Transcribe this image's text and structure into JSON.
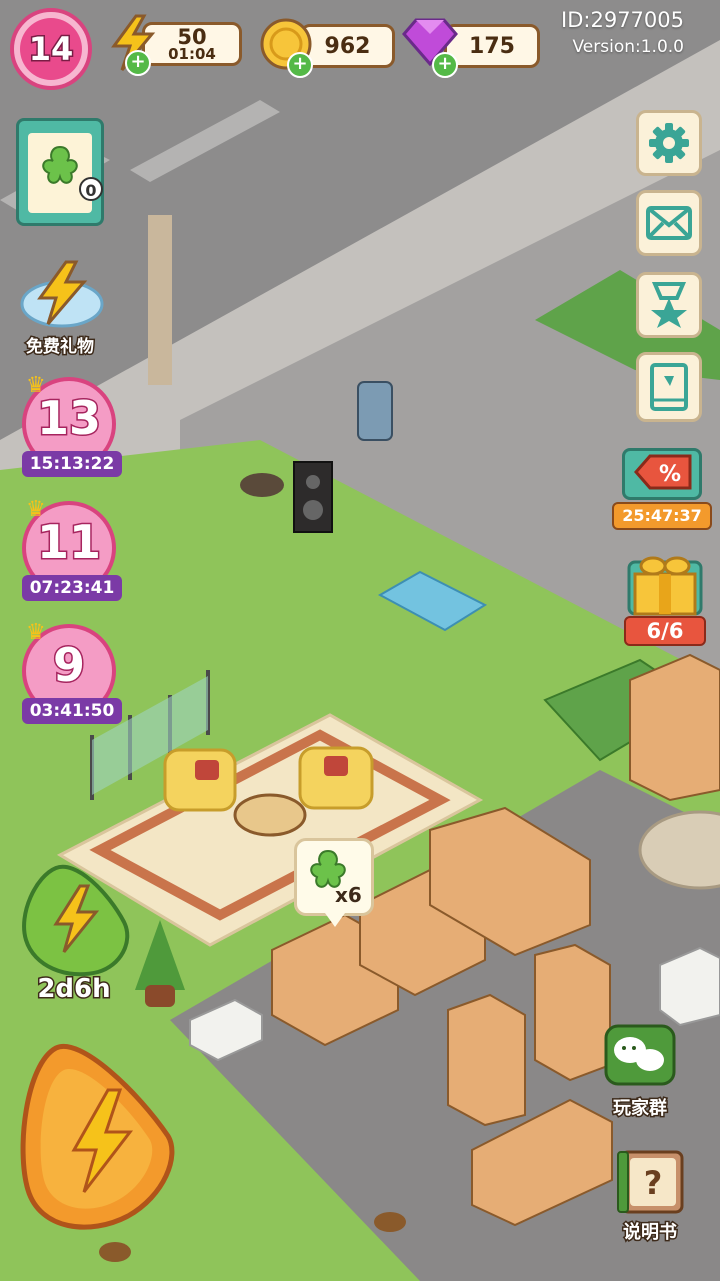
{
  "player": {
    "level": "14",
    "id": "ID:2977005",
    "version": "Version:1.0.0"
  },
  "resources": {
    "energy": {
      "value": "50",
      "timer": "01:04",
      "icon": "lightning-icon"
    },
    "coins": {
      "value": "962",
      "icon": "coin-icon"
    },
    "gems": {
      "value": "175",
      "icon": "gem-icon"
    }
  },
  "left_menu": {
    "task_board": {
      "count": "0",
      "icon": "clipboard-icon"
    },
    "free_gift": {
      "label": "免费礼物",
      "icon": "lightning-gift-icon"
    },
    "level_events": [
      {
        "level": "13",
        "timer": "15:13:22"
      },
      {
        "level": "11",
        "timer": "07:23:41"
      },
      {
        "level": "9",
        "timer": "03:41:50"
      }
    ],
    "energy_boost": {
      "timer": "2d6h",
      "icon": "lightning-icon"
    },
    "main_energy": {
      "icon": "lightning-icon"
    }
  },
  "right_menu": {
    "settings": {
      "icon": "gear-icon"
    },
    "mail": {
      "icon": "mail-icon"
    },
    "achievements": {
      "icon": "star-ribbon-icon"
    },
    "collection": {
      "icon": "book-icon"
    },
    "sale": {
      "timer": "25:47:37",
      "icon": "percent-tag-icon"
    },
    "gift_pack": {
      "progress": "6/6",
      "icon": "gift-box-icon"
    },
    "community": {
      "label": "玩家群",
      "icon": "chat-bubble-icon"
    },
    "manual": {
      "label": "说明书",
      "icon": "question-book-icon"
    }
  },
  "scene": {
    "reward_bubble": {
      "count": "x6",
      "icon": "clover-icon"
    }
  },
  "colors": {
    "road": "#8d8c8c",
    "grass": "#8fc45a",
    "sidewalk": "#c7c4c0",
    "box": "#e6ad75",
    "accent_pink": "#e94a8c",
    "accent_purple": "#7b3aa6"
  }
}
